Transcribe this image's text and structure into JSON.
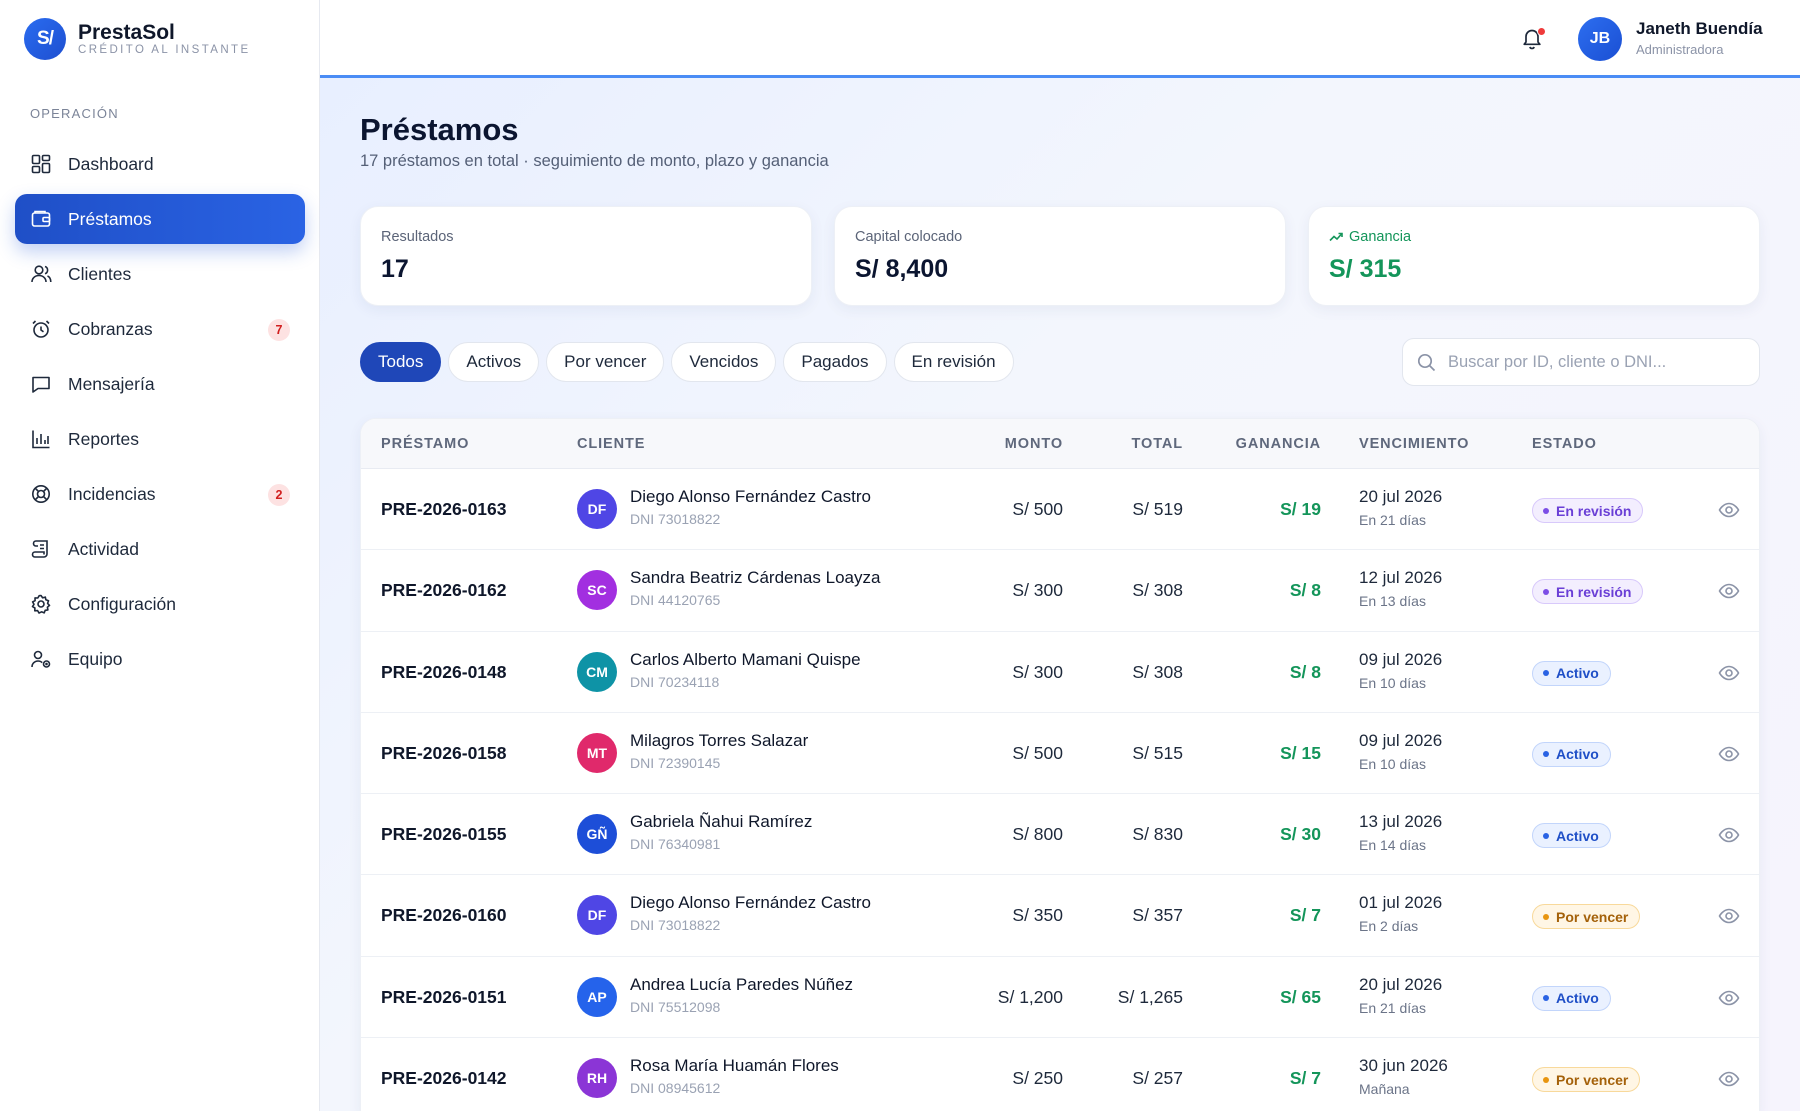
{
  "brand": {
    "logo_text": "S/",
    "name": "PrestaSol",
    "tagline": "CRÉDITO AL INSTANTE"
  },
  "sidebar": {
    "section_label": "OPERACIÓN",
    "items": [
      {
        "label": "Dashboard",
        "icon": "grid-icon",
        "active": false,
        "badge": ""
      },
      {
        "label": "Préstamos",
        "icon": "wallet-icon",
        "active": true,
        "badge": ""
      },
      {
        "label": "Clientes",
        "icon": "users-icon",
        "active": false,
        "badge": ""
      },
      {
        "label": "Cobranzas",
        "icon": "alarm-clock-icon",
        "active": false,
        "badge": "7"
      },
      {
        "label": "Mensajería",
        "icon": "message-icon",
        "active": false,
        "badge": ""
      },
      {
        "label": "Reportes",
        "icon": "bar-chart-icon",
        "active": false,
        "badge": ""
      },
      {
        "label": "Incidencias",
        "icon": "lifebuoy-icon",
        "active": false,
        "badge": "2"
      },
      {
        "label": "Actividad",
        "icon": "scroll-icon",
        "active": false,
        "badge": ""
      },
      {
        "label": "Configuración",
        "icon": "gear-icon",
        "active": false,
        "badge": ""
      },
      {
        "label": "Equipo",
        "icon": "team-icon",
        "active": false,
        "badge": ""
      }
    ]
  },
  "topbar": {
    "user_initials": "JB",
    "user_name": "Janeth Buendía",
    "user_role": "Administradora",
    "has_notification": true
  },
  "page": {
    "title": "Préstamos",
    "subtitle": "17 préstamos en total · seguimiento de monto, plazo y ganancia"
  },
  "stats": [
    {
      "label": "Resultados",
      "value": "17"
    },
    {
      "label": "Capital colocado",
      "value": "S/ 8,400"
    },
    {
      "label": "Ganancia",
      "value": "S/ 315",
      "icon": "trending-up-icon"
    }
  ],
  "filters": [
    "Todos",
    "Activos",
    "Por vencer",
    "Vencidos",
    "Pagados",
    "En revisión"
  ],
  "active_filter": 0,
  "search": {
    "placeholder": "Buscar por ID, cliente o DNI...",
    "value": ""
  },
  "table": {
    "headers": {
      "id": "PRÉSTAMO",
      "client": "CLIENTE",
      "monto": "MONTO",
      "total": "TOTAL",
      "ganancia": "GANANCIA",
      "vencimiento": "VENCIMIENTO",
      "estado": "ESTADO"
    },
    "rows": [
      {
        "id": "PRE-2026-0163",
        "initials": "DF",
        "avatar_color": "#4f46e5",
        "name": "Diego Alonso Fernández Castro",
        "dni": "DNI 73018822",
        "monto": "S/ 500",
        "total": "S/ 519",
        "ganancia": "S/ 19",
        "date": "20 jul 2026",
        "relative": "En 21 días",
        "status": "En revisión",
        "status_kind": "rev"
      },
      {
        "id": "PRE-2026-0162",
        "initials": "SC",
        "avatar_color": "#a22fe0",
        "name": "Sandra Beatriz Cárdenas Loayza",
        "dni": "DNI 44120765",
        "monto": "S/ 300",
        "total": "S/ 308",
        "ganancia": "S/ 8",
        "date": "12 jul 2026",
        "relative": "En 13 días",
        "status": "En revisión",
        "status_kind": "rev"
      },
      {
        "id": "PRE-2026-0148",
        "initials": "CM",
        "avatar_color": "#0e93a6",
        "name": "Carlos Alberto Mamani Quispe",
        "dni": "DNI 70234118",
        "monto": "S/ 300",
        "total": "S/ 308",
        "ganancia": "S/ 8",
        "date": "09 jul 2026",
        "relative": "En 10 días",
        "status": "Activo",
        "status_kind": "act"
      },
      {
        "id": "PRE-2026-0158",
        "initials": "MT",
        "avatar_color": "#e0296b",
        "name": "Milagros Torres Salazar",
        "dni": "DNI 72390145",
        "monto": "S/ 500",
        "total": "S/ 515",
        "ganancia": "S/ 15",
        "date": "09 jul 2026",
        "relative": "En 10 días",
        "status": "Activo",
        "status_kind": "act"
      },
      {
        "id": "PRE-2026-0155",
        "initials": "GÑ",
        "avatar_color": "#1d4ed8",
        "name": "Gabriela Ñahui Ramírez",
        "dni": "DNI 76340981",
        "monto": "S/ 800",
        "total": "S/ 830",
        "ganancia": "S/ 30",
        "date": "13 jul 2026",
        "relative": "En 14 días",
        "status": "Activo",
        "status_kind": "act"
      },
      {
        "id": "PRE-2026-0160",
        "initials": "DF",
        "avatar_color": "#4f46e5",
        "name": "Diego Alonso Fernández Castro",
        "dni": "DNI 73018822",
        "monto": "S/ 350",
        "total": "S/ 357",
        "ganancia": "S/ 7",
        "date": "01 jul 2026",
        "relative": "En 2 días",
        "status": "Por vencer",
        "status_kind": "ven"
      },
      {
        "id": "PRE-2026-0151",
        "initials": "AP",
        "avatar_color": "#2563eb",
        "name": "Andrea Lucía Paredes Núñez",
        "dni": "DNI 75512098",
        "monto": "S/ 1,200",
        "total": "S/ 1,265",
        "ganancia": "S/ 65",
        "date": "20 jul 2026",
        "relative": "En 21 días",
        "status": "Activo",
        "status_kind": "act"
      },
      {
        "id": "PRE-2026-0142",
        "initials": "RH",
        "avatar_color": "#8b35d6",
        "name": "Rosa María Huamán Flores",
        "dni": "DNI 08945612",
        "monto": "S/ 250",
        "total": "S/ 257",
        "ganancia": "S/ 7",
        "date": "30 jun 2026",
        "relative": "Mañana",
        "status": "Por vencer",
        "status_kind": "ven"
      }
    ]
  },
  "colors": {
    "primary": "#1f47b8",
    "gain": "#14955a",
    "badge_red": "#d11f1f"
  }
}
